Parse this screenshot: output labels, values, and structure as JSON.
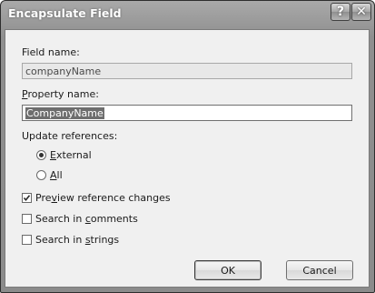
{
  "dialog": {
    "title": "Encapsulate Field",
    "help_glyph": "?",
    "close_glyph": "✕"
  },
  "field_name": {
    "label": "Field name:",
    "value": "companyName"
  },
  "property_name": {
    "label_first": "P",
    "label_rest": "roperty name:",
    "value": "CompanyName"
  },
  "update_references": {
    "label": "Update references:",
    "options": [
      {
        "first": "",
        "mn": "E",
        "rest": "xternal",
        "selected": true
      },
      {
        "first": "",
        "mn": "A",
        "rest": "ll",
        "selected": false
      }
    ]
  },
  "checkboxes": [
    {
      "pre": "Pre",
      "mn": "v",
      "rest": "iew reference changes",
      "checked": true
    },
    {
      "pre": "Search in ",
      "mn": "c",
      "rest": "omments",
      "checked": false
    },
    {
      "pre": "Search in ",
      "mn": "s",
      "rest": "trings",
      "checked": false
    }
  ],
  "buttons": {
    "ok": "OK",
    "cancel": "Cancel"
  }
}
